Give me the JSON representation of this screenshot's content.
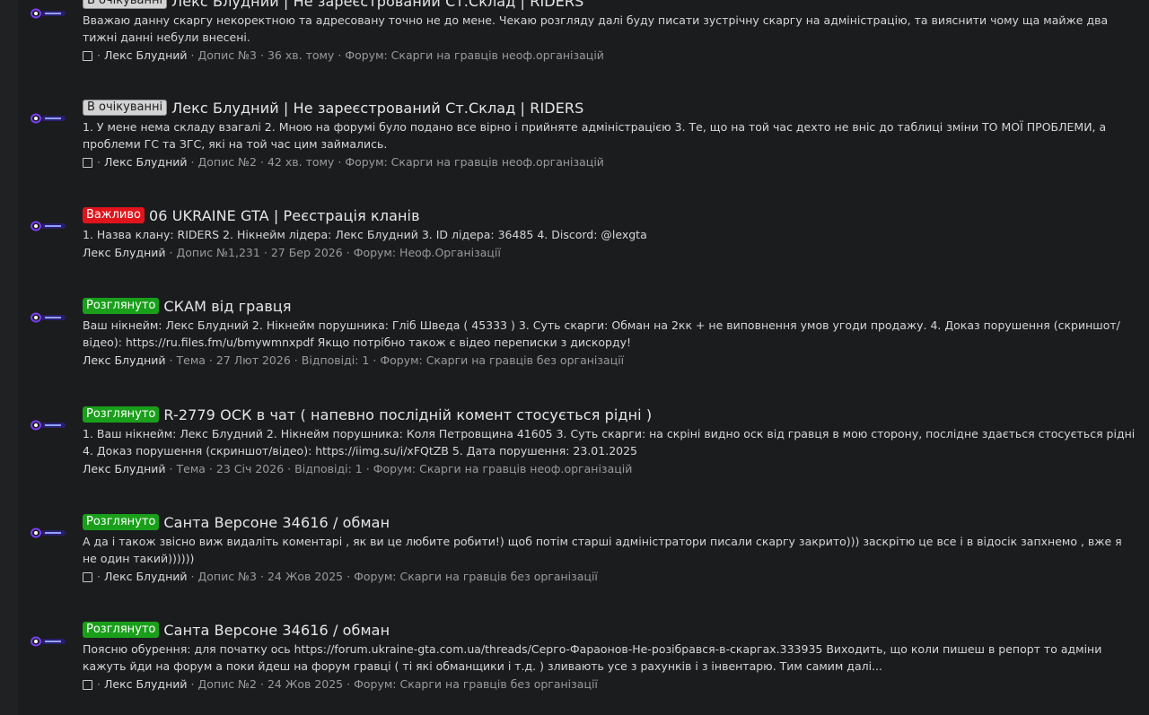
{
  "results": [
    {
      "badge": "В очікуванні",
      "badge_type": "pending",
      "title": "Лекс Блудний | Не зареєстрований Ст.Склад | RIDERS",
      "snippet": "Вважаю данну скаргу некоректною та адресовану точно не до мене. Чекаю розгляду далі буду писати зустрічну скаргу на адміністрацію, та вияснити чому ща майже два тижні данні небули внесені.",
      "has_checkbox": true,
      "author": "Лекс Блудний",
      "meta": [
        "Допис №3",
        "36 хв. тому",
        "Форум: Скарги на гравців неоф.організацій"
      ]
    },
    {
      "badge": "В очікуванні",
      "badge_type": "pending",
      "title": "Лекс Блудний | Не зареєстрований Ст.Склад | RIDERS",
      "snippet": "1. У мене нема складу взагалі 2. Мною на форумі було подано все вірно і прийняте адміністрацією 3. Те, що на той час дехто не вніс до таблиці зміни ТО МОЇ ПРОБЛЕМИ, а проблеми ГС та ЗГС, які на той час цим займались.",
      "has_checkbox": true,
      "author": "Лекс Блудний",
      "meta": [
        "Допис №2",
        "42 хв. тому",
        "Форум: Скарги на гравців неоф.організацій"
      ]
    },
    {
      "badge": "Важливо",
      "badge_type": "important",
      "title": "06 UKRAINE GTA | Реєстрація кланів",
      "snippet": "1. Назва клану: RIDERS 2. Нікнейм лідера: Лекс Блудний 3. ID лідера: 36485 4. Discord: @lexgta",
      "has_checkbox": false,
      "author": "Лекс Блудний",
      "meta": [
        "Допис №1,231",
        "27 Бер 2026",
        "Форум: Неоф.Організації"
      ]
    },
    {
      "badge": "Розглянуто",
      "badge_type": "reviewed",
      "title": "СКАМ від гравця",
      "snippet": "Ваш нікнейм: Лекс Блудний 2. Нікнейм порушника: Гліб Шведа ( 45333 ) 3. Суть скарги: Обман на 2кк + не виповнення умов угоди продажу. 4. Доказ порушення (скриншот/відео): https://ru.files.fm/u/bmywmnxpdf Якщо потрібно також є відео переписки з дискорду!",
      "has_checkbox": false,
      "author": "Лекс Блудний",
      "meta": [
        "Тема",
        "27 Лют 2026",
        "Відповіді: 1",
        "Форум: Скарги на гравців без організації"
      ]
    },
    {
      "badge": "Розглянуто",
      "badge_type": "reviewed",
      "title": "R-2779 ОСК в чат ( напевно послідній комент стосується рідні )",
      "snippet": "1. Ваш нікнейм: Лекс Блудний 2. Нікнейм порушника: Коля Петровщина 41605 3. Суть скарги: на скріні видно оск від гравця в мою сторону, послідне здається стосується рідні 4. Доказ порушення (скриншот/відео): https://iimg.su/i/xFQtZB 5. Дата порушення: 23.01.2025",
      "has_checkbox": false,
      "author": "Лекс Блудний",
      "meta": [
        "Тема",
        "23 Січ 2026",
        "Відповіді: 1",
        "Форум: Скарги на гравців неоф.організацій"
      ]
    },
    {
      "badge": "Розглянуто",
      "badge_type": "reviewed",
      "title": "Санта Версоне 34616 / обман",
      "snippet": "А да і також звісно виж видаліть коментарі , як ви це любите робити!) щоб потім старші адміністратори писали скаргу закрито))) заскрітю це все і в відосік запхнемо , вже я не один такий))))))",
      "has_checkbox": true,
      "author": "Лекс Блудний",
      "meta": [
        "Допис №3",
        "24 Жов 2025",
        "Форум: Скарги на гравців без організації"
      ]
    },
    {
      "badge": "Розглянуто",
      "badge_type": "reviewed",
      "title": "Санта Версоне 34616 / обман",
      "snippet": "Поясню обурення: для початку ось https://forum.ukraine-gta.com.ua/threads/Серго-Фараонов-Не-розібрався-в-скаргах.333935 Виходить, що коли пишеш в репорт то адміни кажуть йди на форум а поки йдеш на форум гравці ( ті які обманщики і т.д. ) зливають усе з рахунків і з інвентарю. Тим самим далі...",
      "has_checkbox": true,
      "author": "Лекс Блудний",
      "meta": [
        "Допис №2",
        "24 Жов 2025",
        "Форум: Скарги на гравців без організації"
      ]
    }
  ],
  "colors": {
    "background": "#1b1c1e",
    "pending_badge": "#d3d3d3",
    "important_badge": "#e0141a",
    "reviewed_badge": "#1a9f1a"
  },
  "icons": {
    "avatar": "avatar-icon",
    "checkbox": "checkbox-icon"
  }
}
